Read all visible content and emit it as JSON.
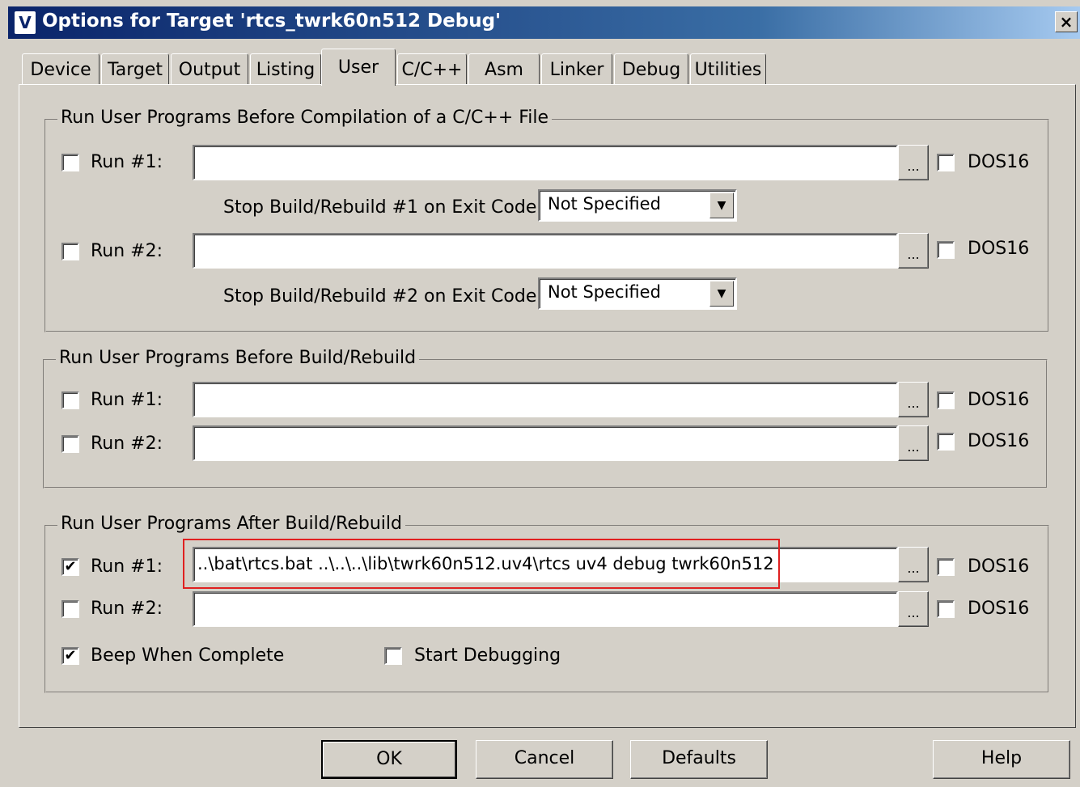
{
  "window": {
    "title": "Options for Target 'rtcs_twrk60n512 Debug'",
    "icon_letter": "V",
    "close_label": "×"
  },
  "tabs": [
    {
      "label": "Device"
    },
    {
      "label": "Target"
    },
    {
      "label": "Output"
    },
    {
      "label": "Listing"
    },
    {
      "label": "User",
      "active": true
    },
    {
      "label": "C/C++"
    },
    {
      "label": "Asm"
    },
    {
      "label": "Linker"
    },
    {
      "label": "Debug"
    },
    {
      "label": "Utilities"
    }
  ],
  "groups": {
    "before_compile": {
      "title": "Run User Programs Before Compilation of a C/C++ File",
      "run1": {
        "label": "Run #1:",
        "checked": false,
        "value": "",
        "dos16": "DOS16",
        "dos16_checked": false
      },
      "stop1": {
        "label": "Stop Build/Rebuild #1 on Exit Code:",
        "value": "Not Specified"
      },
      "run2": {
        "label": "Run #2:",
        "checked": false,
        "value": "",
        "dos16": "DOS16",
        "dos16_checked": false
      },
      "stop2": {
        "label": "Stop Build/Rebuild #2 on Exit Code:",
        "value": "Not Specified"
      }
    },
    "before_build": {
      "title": "Run User Programs Before Build/Rebuild",
      "run1": {
        "label": "Run #1:",
        "checked": false,
        "value": "",
        "dos16": "DOS16",
        "dos16_checked": false
      },
      "run2": {
        "label": "Run #2:",
        "checked": false,
        "value": "",
        "dos16": "DOS16",
        "dos16_checked": false
      }
    },
    "after_build": {
      "title": "Run User Programs After Build/Rebuild",
      "run1": {
        "label": "Run #1:",
        "checked": true,
        "value": "..\\bat\\rtcs.bat ..\\..\\..\\lib\\twrk60n512.uv4\\rtcs uv4 debug twrk60n512",
        "dos16": "DOS16",
        "dos16_checked": false
      },
      "run2": {
        "label": "Run #2:",
        "checked": false,
        "value": "",
        "dos16": "DOS16",
        "dos16_checked": false
      },
      "beep": {
        "label": "Beep When Complete",
        "checked": true
      },
      "start_debug": {
        "label": "Start Debugging",
        "checked": false
      }
    }
  },
  "browse_label": "...",
  "check_mark": "✔",
  "combo_arrow": "▼",
  "buttons": {
    "ok": "OK",
    "cancel": "Cancel",
    "defaults": "Defaults",
    "help": "Help"
  },
  "colors": {
    "highlight": "#e02020",
    "titlebar": "#0a246a"
  }
}
